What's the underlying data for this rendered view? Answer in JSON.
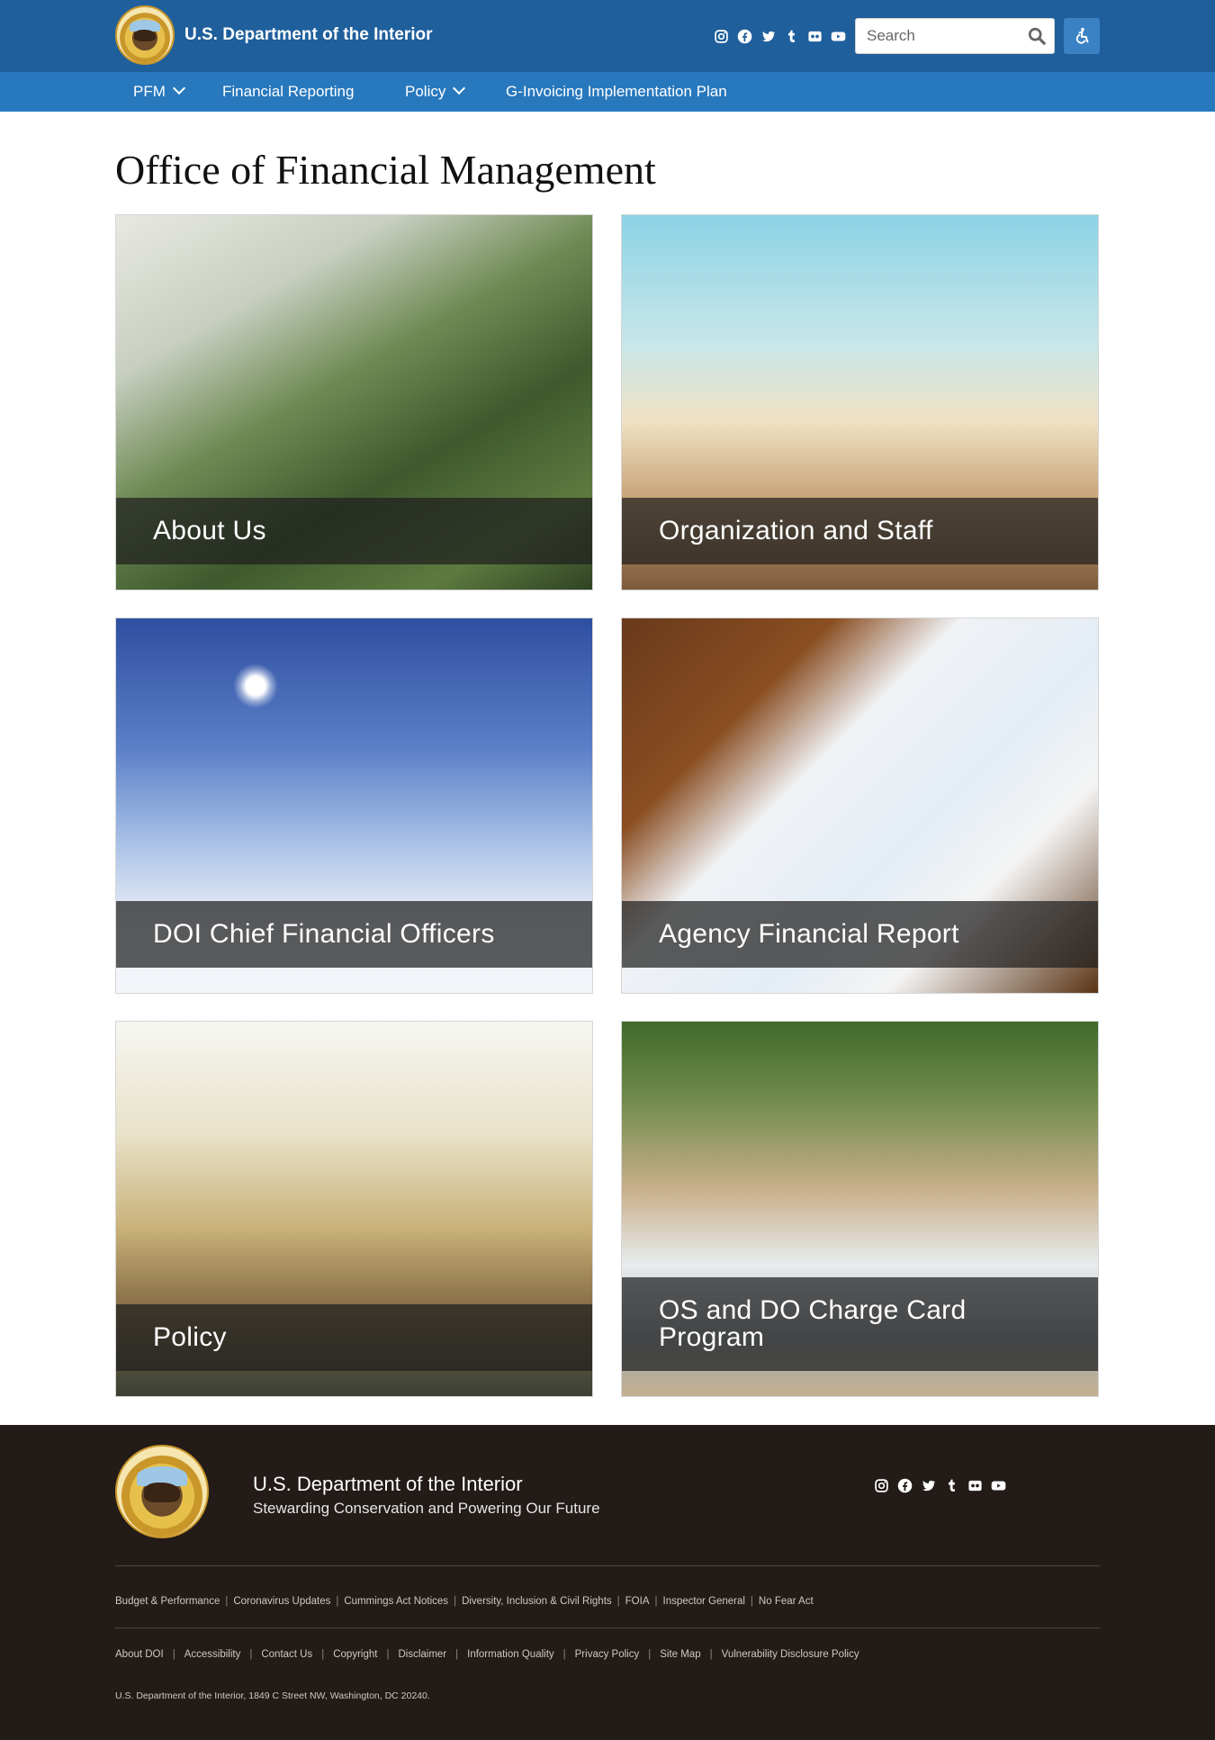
{
  "header": {
    "site_title": "U.S. Department of the Interior",
    "search_placeholder": "Search",
    "social_icons": [
      "instagram-icon",
      "facebook-icon",
      "twitter-icon",
      "tumblr-icon",
      "flickr-icon",
      "youtube-icon"
    ],
    "accessibility_icon": "accessibility-icon"
  },
  "nav": {
    "items": [
      {
        "label": "PFM",
        "has_dropdown": true
      },
      {
        "label": "Financial Reporting",
        "has_dropdown": false
      },
      {
        "label": "Policy",
        "has_dropdown": true
      },
      {
        "label": "G-Invoicing Implementation Plan",
        "has_dropdown": false
      }
    ]
  },
  "main": {
    "title": "Office of Financial Management",
    "cards": [
      {
        "label": "About Us"
      },
      {
        "label": "Organization and Staff"
      },
      {
        "label": "DOI Chief Financial Officers"
      },
      {
        "label": "Agency Financial Report"
      },
      {
        "label": "Policy"
      },
      {
        "label": "OS and DO Charge Card Program"
      }
    ]
  },
  "footer": {
    "title": "U.S. Department of the Interior",
    "tagline": "Stewarding Conservation and Powering Our Future",
    "links_row1": [
      "Budget & Performance",
      "Coronavirus Updates",
      "Cummings Act Notices",
      "Diversity, Inclusion & Civil Rights",
      "FOIA",
      "Inspector General",
      "No Fear Act"
    ],
    "links_row2": [
      "About DOI",
      "Accessibility",
      "Contact Us",
      "Copyright",
      "Disclaimer",
      "Information Quality",
      "Privacy Policy",
      "Site Map",
      "Vulnerability Disclosure Policy"
    ],
    "address": "U.S. Department of the Interior, 1849 C Street NW, Washington, DC 20240."
  },
  "colors": {
    "header_bg": "#1f5f9c",
    "nav_bg": "#2878bd",
    "footer_bg": "#221b17",
    "card_overlay": "#1e1e1e"
  }
}
